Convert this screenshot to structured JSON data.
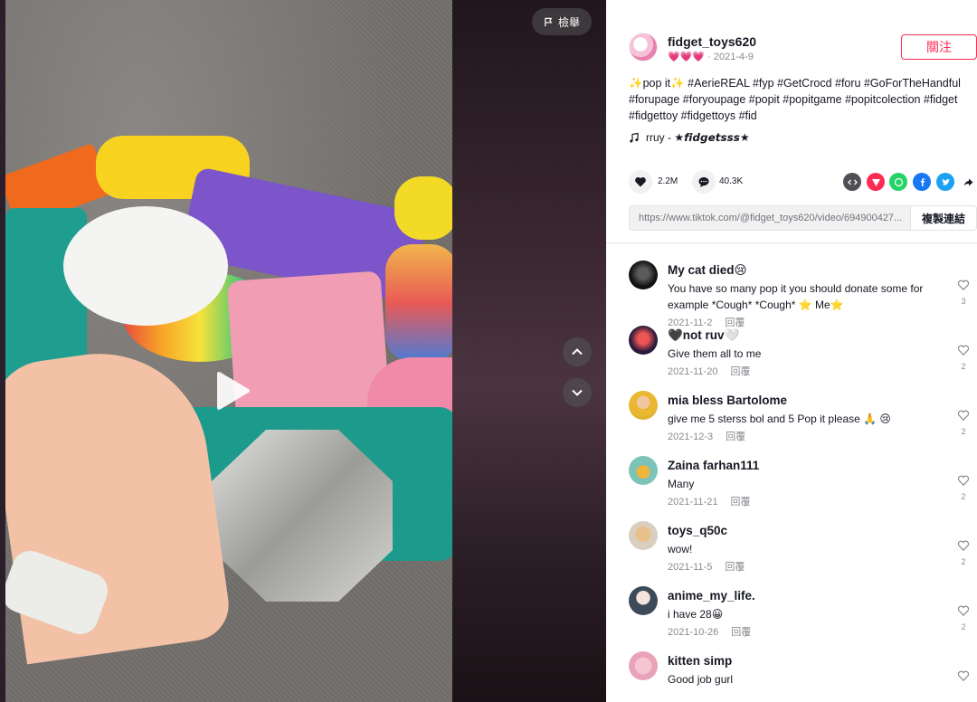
{
  "video": {
    "report_label": "檢舉"
  },
  "author": {
    "username": "fidget_toys620",
    "nickname_emoji": "💗💗💗",
    "date": "2021-4-9",
    "follow_label": "關注"
  },
  "caption": "✨pop it✨ #AerieREAL #fyp #GetCrocd #foru #GoForTheHandful #forupage #foryoupage #popit #popitgame #popitcolection #fidget #fidgettoy #fidgettoys #fid",
  "music": "rruy - ★𝙛𝙞𝙙𝙜𝙚𝙩𝙨𝙨𝙨★",
  "stats": {
    "likes": "2.2M",
    "comments": "40.3K"
  },
  "link": {
    "url": "https://www.tiktok.com/@fidget_toys620/video/694900427...",
    "copy_label": "複製連結"
  },
  "comments": [
    {
      "user": "My cat died😢",
      "text": "You have so many pop it you should donate some for example *Cough* *Cough* ⭐ Me⭐",
      "date": "2021-11-2",
      "reply": "回覆",
      "likes": "3"
    },
    {
      "user": "🖤not ruv🤍",
      "text": "Give them all to me",
      "date": "2021-11-20",
      "reply": "回覆",
      "likes": "2"
    },
    {
      "user": "mia bless Bartolome",
      "text": "give me 5 sterss bol and 5 Pop it please 🙏 😢",
      "date": "2021-12-3",
      "reply": "回覆",
      "likes": "2"
    },
    {
      "user": "Zaina farhan111",
      "text": "Many",
      "date": "2021-11-21",
      "reply": "回覆",
      "likes": "2"
    },
    {
      "user": "toys_q50c",
      "text": "wow!",
      "date": "2021-11-5",
      "reply": "回覆",
      "likes": "2"
    },
    {
      "user": "anime_my_life.",
      "text": "i have 28😀",
      "date": "2021-10-26",
      "reply": "回覆",
      "likes": "2"
    },
    {
      "user": "kitten simp",
      "text": "Good job gurl",
      "date": "",
      "reply": "",
      "likes": ""
    }
  ]
}
